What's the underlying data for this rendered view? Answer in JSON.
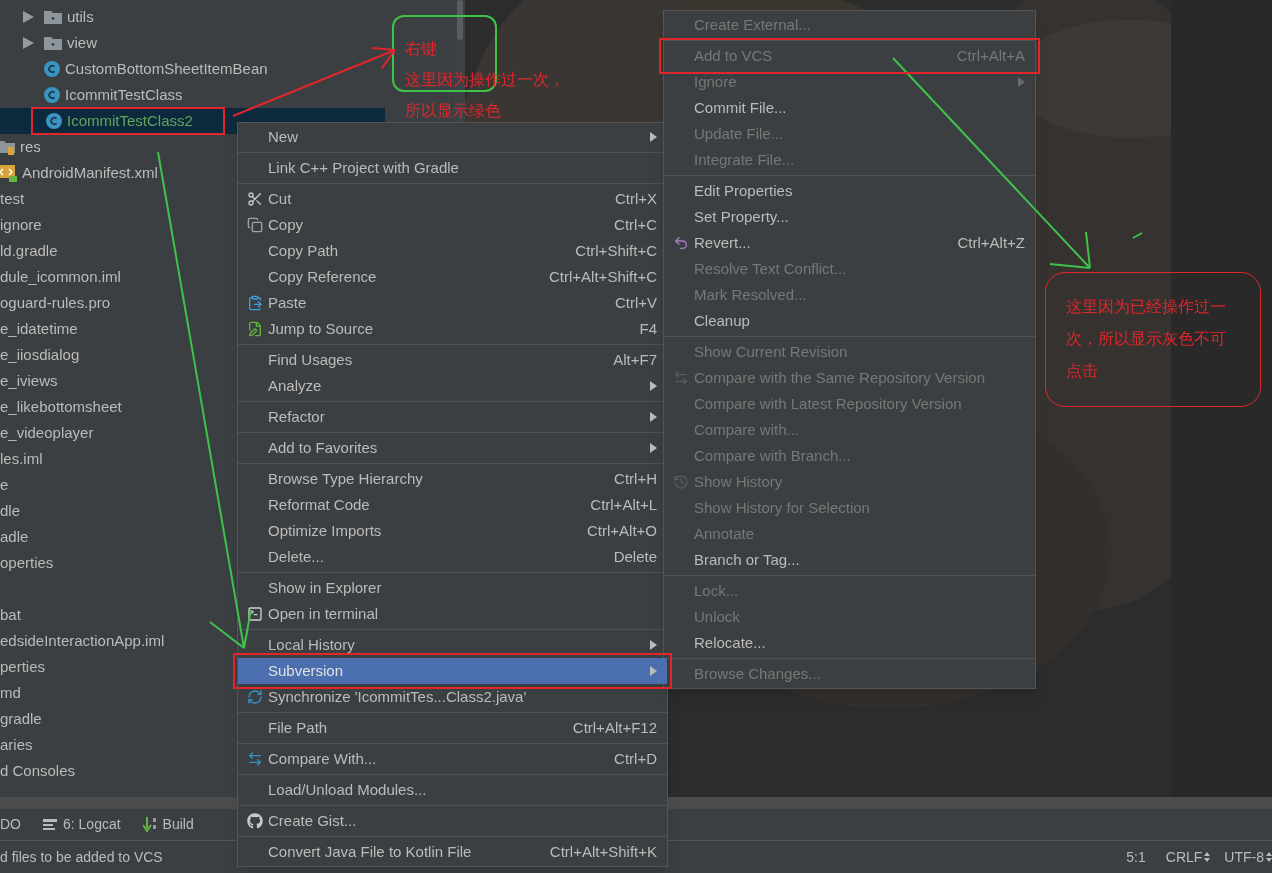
{
  "tree": {
    "rows": [
      {
        "kind": "group",
        "children": [
          {
            "kind": "folder",
            "label": "utils",
            "expanded": false,
            "selected": false
          },
          {
            "kind": "folder",
            "label": "view",
            "expanded": false,
            "selected": false
          },
          {
            "kind": "class",
            "label": "CustomBottomSheetItemBean",
            "selected": false,
            "added": false
          },
          {
            "kind": "class",
            "label": "IcommitTestClass",
            "selected": false,
            "added": false
          },
          {
            "kind": "class",
            "label": "IcommitTestClass2",
            "selected": true,
            "added": true,
            "highlighted": true
          }
        ]
      },
      {
        "kind": "res-folder",
        "label": "res",
        "selected": false
      },
      {
        "kind": "manifest",
        "label": "AndroidManifest.xml",
        "selected": false
      },
      {
        "kind": "file",
        "label": "test",
        "selected": false
      },
      {
        "kind": "file",
        "label": "ignore",
        "selected": false
      },
      {
        "kind": "file",
        "label": "ld.gradle",
        "selected": false
      },
      {
        "kind": "file",
        "label": "dule_icommon.iml",
        "selected": false
      },
      {
        "kind": "file",
        "label": "oguard-rules.pro",
        "selected": false
      },
      {
        "kind": "file",
        "label": "e_idatetime",
        "selected": false
      },
      {
        "kind": "file",
        "label": "e_iiosdialog",
        "selected": false
      },
      {
        "kind": "file",
        "label": "e_iviews",
        "selected": false
      },
      {
        "kind": "file",
        "label": "e_likebottomsheet",
        "selected": false
      },
      {
        "kind": "file",
        "label": "e_videoplayer",
        "selected": false
      },
      {
        "kind": "file",
        "label": "les.iml",
        "selected": false
      },
      {
        "kind": "file",
        "label": "e",
        "selected": false
      },
      {
        "kind": "file",
        "label": "dle",
        "selected": false
      },
      {
        "kind": "file",
        "label": "adle",
        "selected": false
      },
      {
        "kind": "file",
        "label": "operties",
        "selected": false
      },
      {
        "kind": "blank"
      },
      {
        "kind": "file",
        "label": "bat",
        "selected": false
      },
      {
        "kind": "file",
        "label": "edsideInteractionApp.iml",
        "selected": false
      },
      {
        "kind": "file",
        "label": "perties",
        "selected": false
      },
      {
        "kind": "file",
        "label": "md",
        "selected": false
      },
      {
        "kind": "file",
        "label": "gradle",
        "selected": false
      },
      {
        "kind": "file",
        "label": "aries",
        "selected": false
      },
      {
        "kind": "file",
        "label": "d Consoles",
        "selected": false
      }
    ]
  },
  "context_menu": {
    "items": [
      {
        "kind": "item",
        "label": "New",
        "submenu": true
      },
      {
        "kind": "separator"
      },
      {
        "kind": "item",
        "label": "Link C++ Project with Gradle"
      },
      {
        "kind": "separator"
      },
      {
        "kind": "item",
        "label": "Cut",
        "shortcut": "Ctrl+X"
      },
      {
        "kind": "item",
        "label": "Copy",
        "shortcut": "Ctrl+C"
      },
      {
        "kind": "item",
        "label": "Copy Path",
        "shortcut": "Ctrl+Shift+C"
      },
      {
        "kind": "item",
        "label": "Copy Reference",
        "shortcut": "Ctrl+Alt+Shift+C"
      },
      {
        "kind": "item",
        "label": "Paste",
        "shortcut": "Ctrl+V"
      },
      {
        "kind": "item",
        "label": "Jump to Source",
        "shortcut": "F4"
      },
      {
        "kind": "separator"
      },
      {
        "kind": "item",
        "label": "Find Usages",
        "shortcut": "Alt+F7"
      },
      {
        "kind": "item",
        "label": "Analyze",
        "submenu": true
      },
      {
        "kind": "separator"
      },
      {
        "kind": "item",
        "label": "Refactor",
        "submenu": true
      },
      {
        "kind": "separator"
      },
      {
        "kind": "item",
        "label": "Add to Favorites",
        "submenu": true
      },
      {
        "kind": "separator"
      },
      {
        "kind": "item",
        "label": "Browse Type Hierarchy",
        "shortcut": "Ctrl+H"
      },
      {
        "kind": "item",
        "label": "Reformat Code",
        "shortcut": "Ctrl+Alt+L"
      },
      {
        "kind": "item",
        "label": "Optimize Imports",
        "shortcut": "Ctrl+Alt+O"
      },
      {
        "kind": "item",
        "label": "Delete...",
        "shortcut": "Delete"
      },
      {
        "kind": "separator"
      },
      {
        "kind": "item",
        "label": "Show in Explorer"
      },
      {
        "kind": "item",
        "label": "Open in terminal"
      },
      {
        "kind": "separator"
      },
      {
        "kind": "item",
        "label": "Local History",
        "submenu": true
      },
      {
        "kind": "item",
        "label": "Subversion",
        "submenu": true,
        "selected": true,
        "highlighted": true
      },
      {
        "kind": "item",
        "label": "Synchronize 'IcommitTes...Class2.java'"
      },
      {
        "kind": "separator"
      },
      {
        "kind": "item",
        "label": "File Path",
        "shortcut": "Ctrl+Alt+F12"
      },
      {
        "kind": "separator"
      },
      {
        "kind": "item",
        "label": "Compare With...",
        "shortcut": "Ctrl+D"
      },
      {
        "kind": "separator"
      },
      {
        "kind": "item",
        "label": "Load/Unload Modules..."
      },
      {
        "kind": "separator"
      },
      {
        "kind": "item",
        "label": "Create Gist..."
      },
      {
        "kind": "separator"
      },
      {
        "kind": "item",
        "label": "Convert Java File to Kotlin File",
        "shortcut": "Ctrl+Alt+Shift+K"
      }
    ]
  },
  "submenu": {
    "items": [
      {
        "kind": "item",
        "label": "Create External...",
        "disabled": true
      },
      {
        "kind": "separator"
      },
      {
        "kind": "item",
        "label": "Add to VCS",
        "shortcut": "Ctrl+Alt+A",
        "disabled": true,
        "highlighted": true
      },
      {
        "kind": "item",
        "label": "Ignore",
        "disabled": true,
        "submenu": true
      },
      {
        "kind": "item",
        "label": "Commit File...",
        "disabled": false
      },
      {
        "kind": "item",
        "label": "Update File...",
        "disabled": true
      },
      {
        "kind": "item",
        "label": "Integrate File...",
        "disabled": true
      },
      {
        "kind": "separator"
      },
      {
        "kind": "item",
        "label": "Edit Properties",
        "disabled": false
      },
      {
        "kind": "item",
        "label": "Set Property...",
        "disabled": false
      },
      {
        "kind": "item",
        "label": "Revert...",
        "shortcut": "Ctrl+Alt+Z",
        "disabled": false
      },
      {
        "kind": "item",
        "label": "Resolve Text Conflict...",
        "disabled": true
      },
      {
        "kind": "item",
        "label": "Mark Resolved...",
        "disabled": true
      },
      {
        "kind": "item",
        "label": "Cleanup",
        "disabled": false
      },
      {
        "kind": "separator"
      },
      {
        "kind": "item",
        "label": "Show Current Revision",
        "disabled": true
      },
      {
        "kind": "item",
        "label": "Compare with the Same Repository Version",
        "disabled": true
      },
      {
        "kind": "item",
        "label": "Compare with Latest Repository Version",
        "disabled": true
      },
      {
        "kind": "item",
        "label": "Compare with...",
        "disabled": true
      },
      {
        "kind": "item",
        "label": "Compare with Branch...",
        "disabled": true
      },
      {
        "kind": "item",
        "label": "Show History",
        "disabled": true
      },
      {
        "kind": "item",
        "label": "Show History for Selection",
        "disabled": true
      },
      {
        "kind": "item",
        "label": "Annotate",
        "disabled": true
      },
      {
        "kind": "item",
        "label": "Branch or Tag...",
        "disabled": false
      },
      {
        "kind": "separator"
      },
      {
        "kind": "item",
        "label": "Lock...",
        "disabled": true
      },
      {
        "kind": "item",
        "label": "Unlock",
        "disabled": true
      },
      {
        "kind": "item",
        "label": "Relocate...",
        "disabled": false
      },
      {
        "kind": "separator"
      },
      {
        "kind": "item",
        "label": "Browse Changes...",
        "disabled": true
      }
    ]
  },
  "tool_bar": {
    "items": [
      "DO",
      "6: Logcat",
      "Build"
    ]
  },
  "status_bar": {
    "message": "d files to be added to VCS",
    "position": "5:1",
    "line_separator": "CRLF",
    "encoding": "UTF-8"
  },
  "annotations": [
    {
      "kind": "green-note",
      "lines": [
        "右键",
        "这里因为操作过一次，",
        "所以显示绿色"
      ]
    },
    {
      "kind": "red-note",
      "text": "这里因为已经操作过一次，所以显示灰色不可点击"
    }
  ]
}
